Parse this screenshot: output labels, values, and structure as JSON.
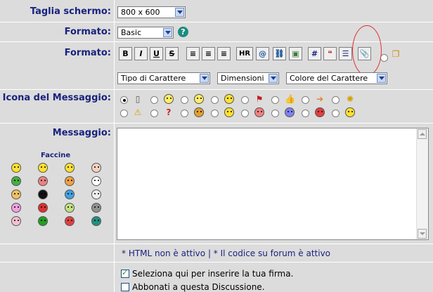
{
  "screen": {
    "label": "Taglia schermo:",
    "value": "800 x 600"
  },
  "format1": {
    "label": "Formato:",
    "value": "Basic",
    "help_icon": "help-icon"
  },
  "format2": {
    "label": "Formato:",
    "buttons": [
      {
        "name": "bold",
        "text": "B"
      },
      {
        "name": "italic",
        "text": "I"
      },
      {
        "name": "underline",
        "text": "U"
      },
      {
        "name": "strike",
        "text": "S"
      },
      {
        "name": "align-left",
        "text": "≡"
      },
      {
        "name": "align-center",
        "text": "≡"
      },
      {
        "name": "align-right",
        "text": "≡"
      },
      {
        "name": "hr",
        "text": "HR"
      },
      {
        "name": "email",
        "text": "@"
      },
      {
        "name": "link",
        "text": "⛓"
      },
      {
        "name": "image",
        "text": "▣"
      },
      {
        "name": "number",
        "text": "#"
      },
      {
        "name": "quote",
        "text": "❝"
      },
      {
        "name": "list",
        "text": "☰"
      },
      {
        "name": "attach",
        "text": "📎"
      }
    ],
    "font": "Tipo di Carattere",
    "size": "Dimensioni",
    "color": "Colore del Carattere"
  },
  "icon": {
    "label": "Icona del Messaggio:"
  },
  "message": {
    "label": "Messaggio:",
    "smilies_title": "Faccine"
  },
  "note": "* HTML non è attivo | * Il codice su forum è attivo",
  "options": {
    "signature": "Seleziona qui per inserire la tua firma.",
    "subscribe": "Abbonati a questa Discussione."
  },
  "colors": {
    "label": "#1a237e",
    "bg": "#dcdcdc",
    "annotation": "#e03030"
  }
}
